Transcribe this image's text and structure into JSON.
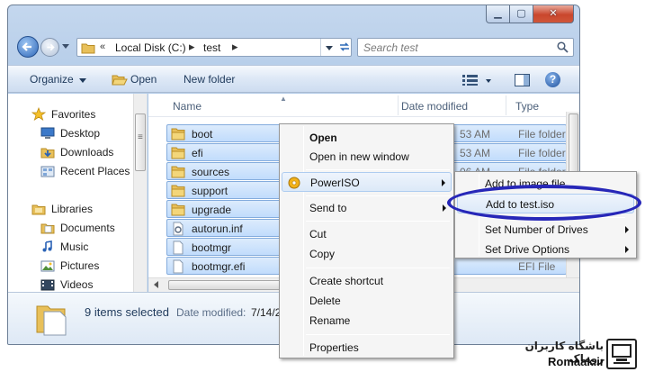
{
  "window": {
    "caption_min": "▁",
    "caption_max": "▢",
    "caption_close": "✕"
  },
  "address": {
    "separator": "«",
    "crumb_sep": "▸",
    "crumbs": [
      "Local Disk (C:)",
      "test"
    ]
  },
  "search": {
    "placeholder": "Search test"
  },
  "toolbar": {
    "organize_label": "Organize",
    "open_label": "Open",
    "newfolder_label": "New folder",
    "help_glyph": "?"
  },
  "nav": {
    "items": [
      {
        "label": "Favorites",
        "icon": "star-icon"
      },
      {
        "label": "Desktop",
        "icon": "desktop-icon"
      },
      {
        "label": "Downloads",
        "icon": "downloads-icon"
      },
      {
        "label": "Recent Places",
        "icon": "recent-places-icon"
      },
      {
        "label": "Libraries",
        "icon": "libraries-icon"
      },
      {
        "label": "Documents",
        "icon": "documents-icon"
      },
      {
        "label": "Music",
        "icon": "music-icon"
      },
      {
        "label": "Pictures",
        "icon": "pictures-icon"
      },
      {
        "label": "Videos",
        "icon": "videos-icon"
      }
    ]
  },
  "files": {
    "columns": {
      "name": "Name",
      "date": "Date modified",
      "type": "Type"
    },
    "rows": [
      {
        "name": "boot",
        "date": "53 AM",
        "type": "File folder",
        "kind": "folder"
      },
      {
        "name": "efi",
        "date": "53 AM",
        "type": "File folder",
        "kind": "folder"
      },
      {
        "name": "sources",
        "date": "06 AM",
        "type": "File folder",
        "kind": "folder"
      },
      {
        "name": "support",
        "date": "",
        "type": "File folder",
        "kind": "folder"
      },
      {
        "name": "upgrade",
        "date": "",
        "type": "File folder",
        "kind": "folder"
      },
      {
        "name": "autorun.inf",
        "date": "",
        "type": "n Infor...",
        "kind": "inf"
      },
      {
        "name": "bootmgr",
        "date": "",
        "type": "",
        "kind": "file"
      },
      {
        "name": "bootmgr.efi",
        "date": "",
        "type": "EFI File",
        "kind": "file"
      }
    ]
  },
  "details": {
    "count": "9 items selected",
    "date_label": "Date modified:",
    "date_value": "7/14/2"
  },
  "context_menu": {
    "items": [
      "Open",
      "Open in new window",
      "PowerISO",
      "Send to",
      "Cut",
      "Copy",
      "Create shortcut",
      "Delete",
      "Rename",
      "Properties"
    ]
  },
  "submenu": {
    "items": [
      "Add to image file...",
      "Add to test.iso",
      "Set Number of Drives",
      "Set Drive Options"
    ]
  },
  "watermark": {
    "line1": "باشگاه کاربران روماک",
    "line2": "Romaak.ir"
  },
  "colors": {
    "selection": "#cce4fc",
    "accent": "#2727b8",
    "folder": "#e8c05a"
  }
}
